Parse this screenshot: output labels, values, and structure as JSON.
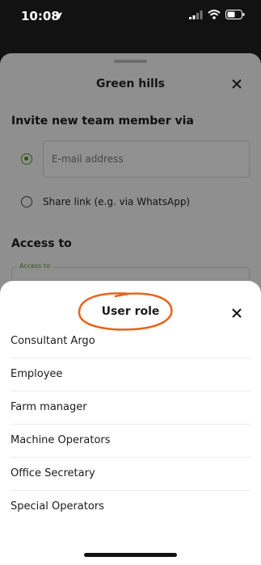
{
  "status": {
    "time": "10:08",
    "icons": [
      "location-arrow-icon",
      "cellular-signal-icon",
      "wifi-icon",
      "battery-icon"
    ]
  },
  "invite_sheet": {
    "title": "Green hills",
    "invite_heading": "Invite new team member via",
    "email_placeholder": "E-mail address",
    "email_option_selected": true,
    "share_link_label": "Share link (e.g. via WhatsApp)",
    "access_heading": "Access to",
    "access_field_label": "Access to"
  },
  "role_sheet": {
    "title": "User role",
    "highlight_color": "#e8641c",
    "roles": [
      "Consultant Argo",
      "Employee",
      "Farm manager",
      "Machine Operators",
      "Office Secretary",
      "Special Operators"
    ]
  },
  "colors": {
    "accent_green": "#5b8a22",
    "annotation_orange": "#e8641c"
  }
}
